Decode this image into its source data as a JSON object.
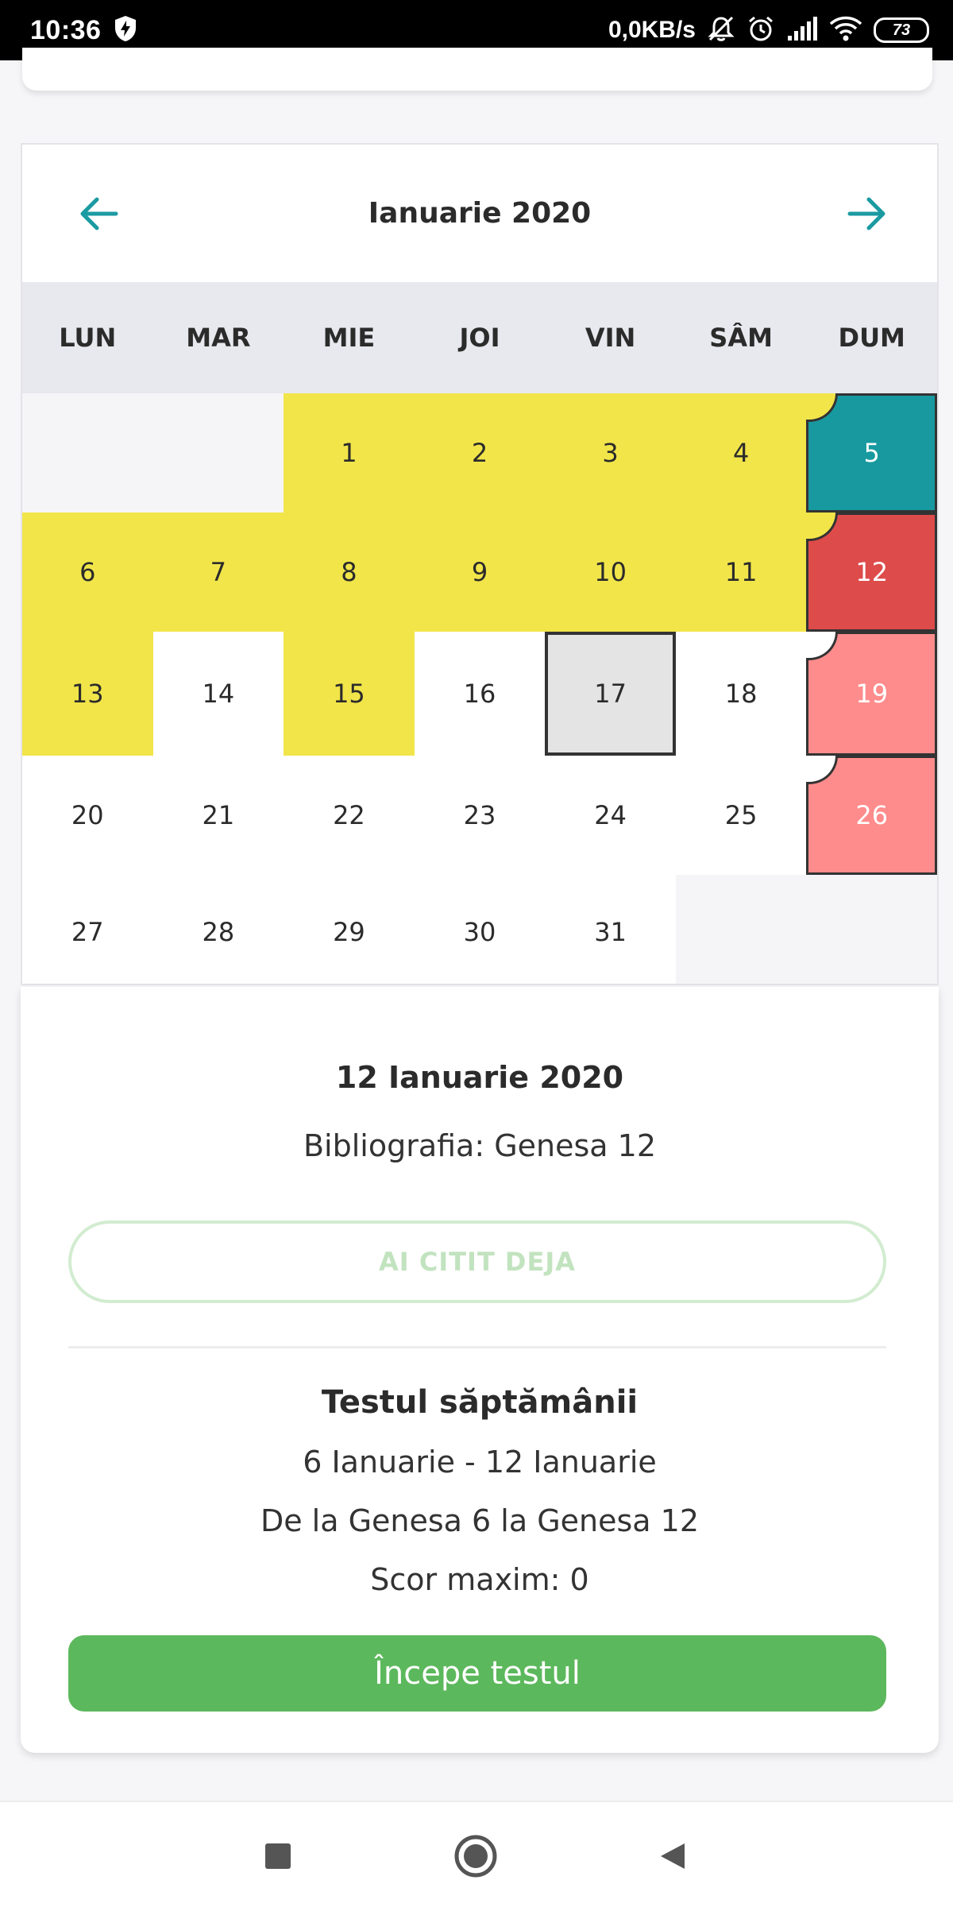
{
  "status_bar": {
    "time": "10:36",
    "net_speed": "0,0KB/s",
    "battery": "73"
  },
  "calendar": {
    "month_title": "Ianuarie 2020",
    "weekdays": [
      "LUN",
      "MAR",
      "MIE",
      "JOI",
      "VIN",
      "SÂM",
      "DUM"
    ],
    "colors": {
      "read": "#f2e54a",
      "teal": "#17999f",
      "red": "#de4b4b",
      "pink": "#ff8c8c",
      "today": "#e4e4e4",
      "arrow": "#1b9aa2"
    },
    "weeks": [
      [
        {
          "label": "",
          "state": "empty"
        },
        {
          "label": "",
          "state": "empty"
        },
        {
          "label": "1",
          "state": "read"
        },
        {
          "label": "2",
          "state": "read"
        },
        {
          "label": "3",
          "state": "read"
        },
        {
          "label": "4",
          "state": "read"
        },
        {
          "label": "5",
          "state": "sunday-teal",
          "corner": "yellow"
        }
      ],
      [
        {
          "label": "6",
          "state": "read"
        },
        {
          "label": "7",
          "state": "read"
        },
        {
          "label": "8",
          "state": "read"
        },
        {
          "label": "9",
          "state": "read"
        },
        {
          "label": "10",
          "state": "read"
        },
        {
          "label": "11",
          "state": "read"
        },
        {
          "label": "12",
          "state": "sunday-red",
          "corner": "yellow"
        }
      ],
      [
        {
          "label": "13",
          "state": "read"
        },
        {
          "label": "14",
          "state": "none"
        },
        {
          "label": "15",
          "state": "read"
        },
        {
          "label": "16",
          "state": "none"
        },
        {
          "label": "17",
          "state": "today"
        },
        {
          "label": "18",
          "state": "none"
        },
        {
          "label": "19",
          "state": "sunday-pink",
          "corner": "white"
        }
      ],
      [
        {
          "label": "20",
          "state": "none"
        },
        {
          "label": "21",
          "state": "none"
        },
        {
          "label": "22",
          "state": "none"
        },
        {
          "label": "23",
          "state": "none"
        },
        {
          "label": "24",
          "state": "none"
        },
        {
          "label": "25",
          "state": "none"
        },
        {
          "label": "26",
          "state": "sunday-pink",
          "corner": "white"
        }
      ],
      [
        {
          "label": "27",
          "state": "none"
        },
        {
          "label": "28",
          "state": "none"
        },
        {
          "label": "29",
          "state": "none"
        },
        {
          "label": "30",
          "state": "none"
        },
        {
          "label": "31",
          "state": "none"
        },
        {
          "label": "",
          "state": "empty"
        },
        {
          "label": "",
          "state": "empty"
        }
      ]
    ]
  },
  "detail": {
    "selected_date": "12 Ianuarie 2020",
    "bibliography": "Bibliografia: Genesa 12",
    "read_button": "AI CITIT DEJA",
    "test_title": "Testul săptămânii",
    "test_range": "6 Ianuarie - 12 Ianuarie",
    "test_chapters": "De la Genesa 6 la Genesa 12",
    "test_score": "Scor maxim: 0",
    "start_button": "Începe testul"
  }
}
